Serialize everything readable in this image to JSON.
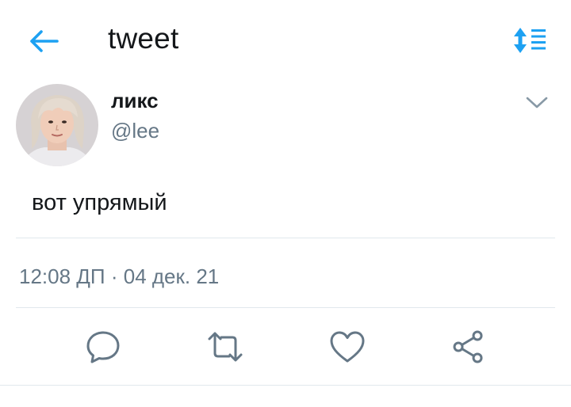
{
  "header": {
    "title": "tweet",
    "back_icon": "arrow-left-icon",
    "sort_icon": "sort-list-icon"
  },
  "tweet": {
    "display_name": "ликс",
    "handle": "@lee",
    "text": "вот упрямый",
    "time": "12:08 ДП",
    "separator": "·",
    "date": "04 дек. 21",
    "menu_icon": "chevron-down-icon"
  },
  "actions": [
    {
      "name": "reply",
      "icon": "speech-bubble-icon"
    },
    {
      "name": "retweet",
      "icon": "retweet-icon"
    },
    {
      "name": "like",
      "icon": "heart-icon"
    },
    {
      "name": "share",
      "icon": "share-icon"
    }
  ],
  "colors": {
    "accent": "#1da1f2",
    "text": "#14171a",
    "muted": "#657786",
    "divider": "#e1e8ed"
  }
}
